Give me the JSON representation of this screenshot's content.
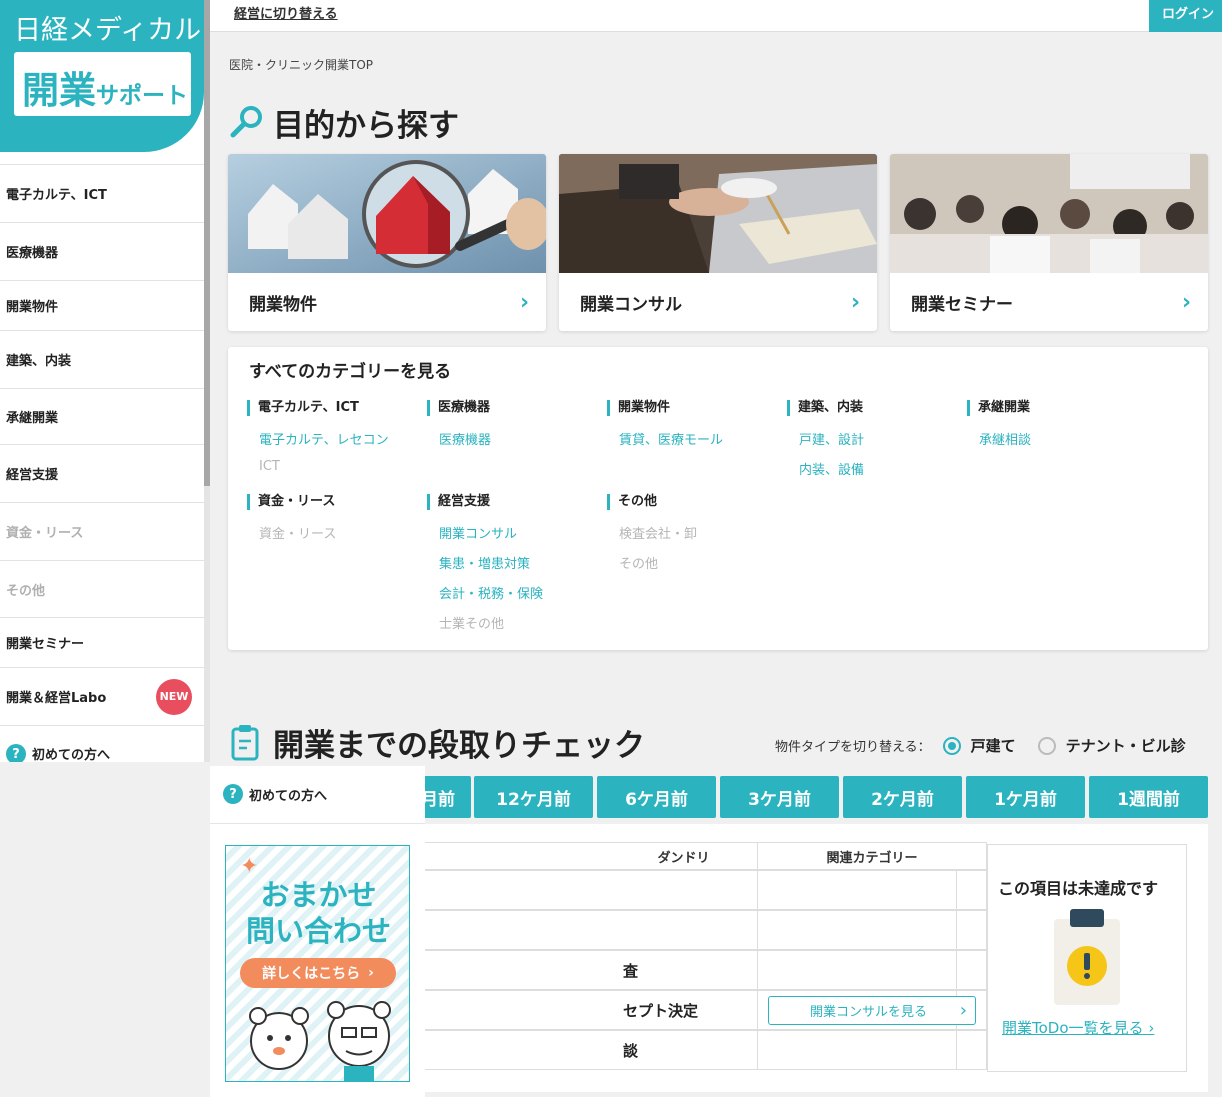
{
  "brand": {
    "line1": "日経メディカル",
    "line2_big": "開業",
    "line2_small": "サポート",
    "color": "#2bb3c0"
  },
  "topbar": {
    "switch_link": "経営に切り替える",
    "login": "ログイン"
  },
  "sidebar": {
    "items": [
      {
        "label": "電子カルテ、ICT",
        "gray": false
      },
      {
        "label": "医療機器",
        "gray": false
      },
      {
        "label": "開業物件",
        "gray": false
      },
      {
        "label": "建築、内装",
        "gray": false
      },
      {
        "label": "承継開業",
        "gray": false
      },
      {
        "label": "経営支援",
        "gray": false
      },
      {
        "label": "資金・リース",
        "gray": true
      },
      {
        "label": "その他",
        "gray": true
      },
      {
        "label": "開業セミナー",
        "gray": false
      },
      {
        "label": "開業＆経営Labo",
        "gray": false
      },
      {
        "label": "初めての方へ",
        "gray": false
      }
    ],
    "new_badge": "NEW"
  },
  "breadcrumb": "医院・クリニック開業TOP",
  "purpose": {
    "title": "目的から探す",
    "cards": [
      {
        "label": "開業物件"
      },
      {
        "label": "開業コンサル"
      },
      {
        "label": "開業セミナー"
      }
    ]
  },
  "categories": {
    "title": "すべてのカテゴリーを見る",
    "groups": [
      {
        "head": "電子カルテ、ICT",
        "links": [
          "電子カルテ、レセコン",
          "ICT"
        ]
      },
      {
        "head": "医療機器",
        "links": [
          "医療機器"
        ]
      },
      {
        "head": "開業物件",
        "links": [
          "賃貸、医療モール"
        ]
      },
      {
        "head": "建築、内装",
        "links": [
          "戸建、設計",
          "内装、設備"
        ]
      },
      {
        "head": "承継開業",
        "links": [
          "承継相談"
        ]
      },
      {
        "head": "資金・リース",
        "links": [
          "資金・リース"
        ]
      },
      {
        "head": "経営支援",
        "links": [
          "開業コンサル",
          "集患・増患対策",
          "会計・税務・保険",
          "士業その他"
        ]
      },
      {
        "head": "その他",
        "links": [
          "検査会社・卸",
          "その他"
        ]
      }
    ]
  },
  "checklist": {
    "title": "開業までの段取りチェック",
    "switch_label": "物件タイプを切り替える：",
    "options": [
      "戸建て",
      "テナント・ビル診"
    ],
    "tabs": [
      "月前",
      "12ケ月前",
      "6ケ月前",
      "3ケ月前",
      "2ケ月前",
      "1ケ月前",
      "1週間前"
    ],
    "table": {
      "col_dandori": "ダンドリ",
      "col_category": "関連カテゴリー",
      "rows": [
        "",
        "",
        "査",
        "セプト決定",
        "談"
      ],
      "consult_button": "開業コンサルを見る"
    },
    "status": {
      "title": "この項目は未達成です",
      "todo_link": "開業ToDo一覧を見る"
    }
  },
  "overlay": {
    "help": "初めての方へ",
    "banner": {
      "line1": "おまかせ",
      "line2": "問い合わせ",
      "button": "詳しくはこちら"
    }
  }
}
